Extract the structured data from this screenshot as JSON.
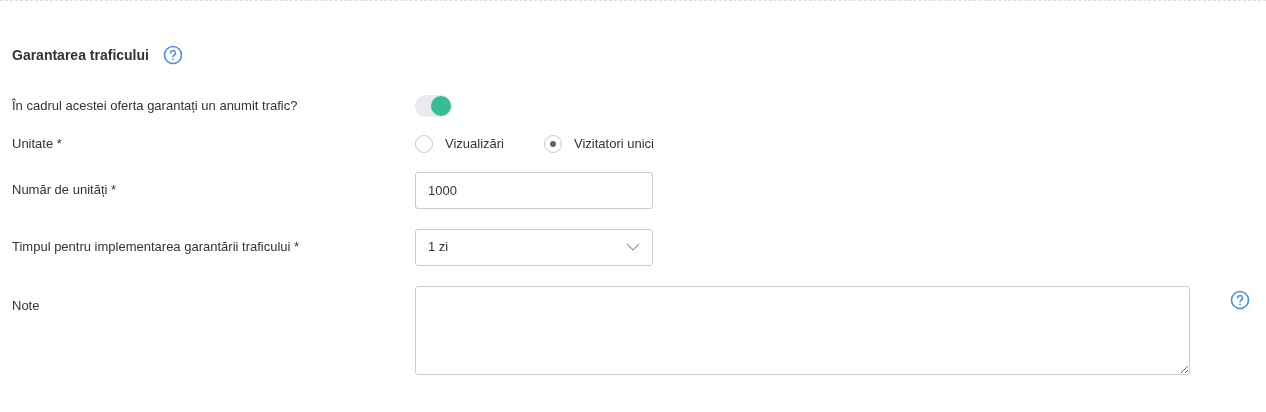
{
  "section": {
    "title": "Garantarea traficului",
    "help": true
  },
  "fields": [
    {
      "kind": "toggle",
      "label": "În cadrul acestei oferta garantați un anumit trafic?",
      "on": true
    },
    {
      "kind": "radio",
      "label": "Unitate *",
      "options": [
        {
          "label": "Vizualizări",
          "selected": false
        },
        {
          "label": "Vizitatori unici",
          "selected": true
        }
      ]
    },
    {
      "kind": "input",
      "label": "Număr de unități *",
      "value": "1000"
    },
    {
      "kind": "select",
      "label": "Timpul pentru implementarea garantării traficului *",
      "value": "1 zi"
    },
    {
      "kind": "textarea",
      "label": "Note",
      "help": true
    }
  ]
}
